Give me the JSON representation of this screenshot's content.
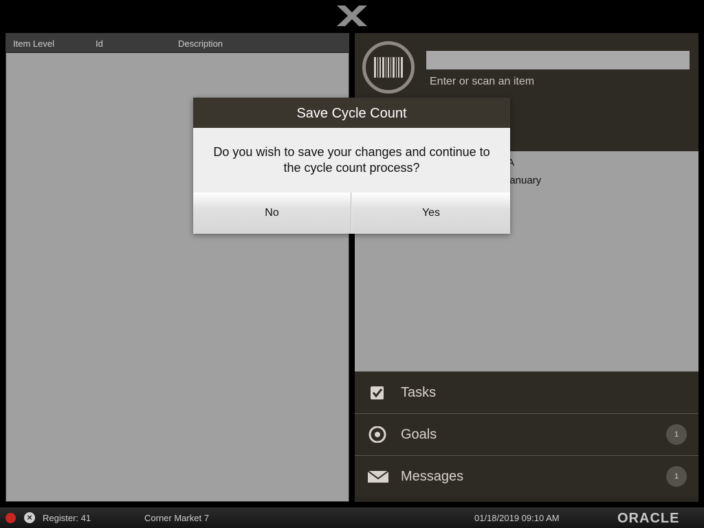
{
  "app": {
    "logo": "X"
  },
  "grid": {
    "columns": [
      "Item Level",
      "Id",
      "Description"
    ]
  },
  "scan": {
    "value": "",
    "hint": "Enter or scan an item"
  },
  "info": {
    "line1": "A",
    "line2": "january"
  },
  "menu": {
    "items": [
      {
        "label": "Tasks",
        "icon": "checkbox-icon"
      },
      {
        "label": "Goals",
        "icon": "target-icon",
        "badge": "1"
      },
      {
        "label": "Messages",
        "icon": "envelope-icon",
        "badge": "1"
      }
    ]
  },
  "dialog": {
    "title": "Save Cycle Count",
    "message": "Do you wish to save your changes and continue to the cycle count process?",
    "no_label": "No",
    "yes_label": "Yes"
  },
  "status": {
    "register": "Register: 41",
    "store": "Corner Market 7",
    "datetime": "01/18/2019 09:10 AM",
    "brand": "ORACLE"
  },
  "colors": {
    "panel_dark": "#2e2a24",
    "status_red": "#c8261e"
  }
}
